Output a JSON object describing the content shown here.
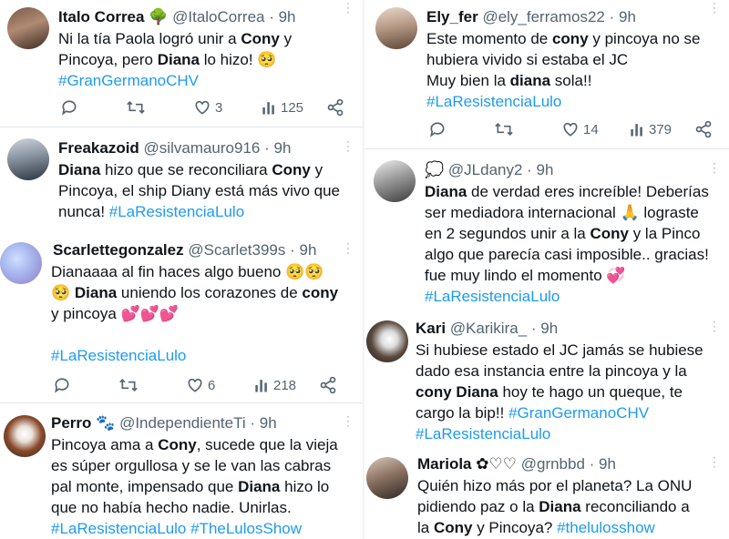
{
  "tweets": [
    {
      "name": "Italo Correa",
      "badge": "🌳",
      "handle": "@ItaloCorrea",
      "time": "· 9h",
      "lines": [
        [
          {
            "t": "Ni la tía Paola logró unir a "
          },
          {
            "t": "Cony",
            "b": 1
          },
          {
            "t": " y"
          }
        ],
        [
          {
            "t": "Pincoya, pero "
          },
          {
            "t": "Diana",
            "b": 1
          },
          {
            "t": " lo hizo! 🥺"
          }
        ],
        [
          {
            "t": "#GranGermanoCHV",
            "tag": 1
          }
        ]
      ],
      "replies": "",
      "retweets": "",
      "likes": "3",
      "views": "125"
    },
    {
      "name": "Freakazoid",
      "badge": "",
      "handle": "@silvamauro916",
      "time": "· 9h",
      "lines": [
        [
          {
            "t": "Diana",
            "b": 1
          },
          {
            "t": " hizo que se reconciliara "
          },
          {
            "t": "Cony",
            "b": 1
          },
          {
            "t": " y"
          }
        ],
        [
          {
            "t": "Pincoya, el ship Diany está más vivo que"
          }
        ],
        [
          {
            "t": "nunca! "
          },
          {
            "t": "#LaResistenciaLulo",
            "tag": 1
          }
        ]
      ]
    },
    {
      "name": "Scarlettegonzalez",
      "badge": "",
      "handle": "@Scarlet399s",
      "time": "· 9h",
      "lines": [
        [
          {
            "t": "Dianaaaa al fin haces algo bueno 🥺🥺"
          }
        ],
        [
          {
            "t": "🥺 "
          },
          {
            "t": "Diana",
            "b": 1
          },
          {
            "t": " uniendo los corazones de "
          },
          {
            "t": "cony",
            "b": 1
          }
        ],
        [
          {
            "t": "y pincoya 💕💕💕"
          }
        ],
        [
          {
            "t": ""
          }
        ],
        [
          {
            "t": "#LaResistenciaLulo",
            "tag": 1
          }
        ]
      ],
      "replies": "",
      "retweets": "",
      "likes": "6",
      "views": "218"
    },
    {
      "name": "Perro",
      "badge": "🐾",
      "handle": "@IndependienteTi",
      "time": "· 9h",
      "lines": [
        [
          {
            "t": "Pincoya ama a "
          },
          {
            "t": "Cony",
            "b": 1
          },
          {
            "t": ", sucede que la vieja"
          }
        ],
        [
          {
            "t": "es súper orgullosa y se le van las cabras"
          }
        ],
        [
          {
            "t": "pal monte, impensado que "
          },
          {
            "t": "Diana",
            "b": 1
          },
          {
            "t": " hizo lo"
          }
        ],
        [
          {
            "t": "que no había hecho nadie. Unirlas."
          }
        ],
        [
          {
            "t": "#LaResistenciaLulo #TheLulosShow",
            "tag": 1
          }
        ]
      ]
    },
    {
      "name": "Ely_fer",
      "badge": "",
      "handle": "@ely_ferramos22",
      "time": "· 9h",
      "lines": [
        [
          {
            "t": "Este momento de "
          },
          {
            "t": "cony",
            "b": 1
          },
          {
            "t": " y pincoya  no se"
          }
        ],
        [
          {
            "t": "hubiera vivido si estaba el JC"
          }
        ],
        [
          {
            "t": "Muy bien la "
          },
          {
            "t": "diana",
            "b": 1
          },
          {
            "t": " sola!!"
          }
        ],
        [
          {
            "t": "#LaResistenciaLulo",
            "tag": 1
          }
        ]
      ],
      "replies": "",
      "retweets": "",
      "likes": "14",
      "views": "379"
    },
    {
      "name": "💭",
      "badge": "",
      "handle": "@JLdany2",
      "time": "· 9h",
      "lines": [
        [
          {
            "t": "Diana",
            "b": 1
          },
          {
            "t": " de verdad eres increíble! Deberías"
          }
        ],
        [
          {
            "t": "ser mediadora internacional 🙏 lograste"
          }
        ],
        [
          {
            "t": "en 2 segundos unir a la "
          },
          {
            "t": "Cony",
            "b": 1
          },
          {
            "t": " y la Pinco"
          }
        ],
        [
          {
            "t": "algo que parecía casi imposible.. gracias!"
          }
        ],
        [
          {
            "t": "fue muy lindo el momento 💞"
          }
        ],
        [
          {
            "t": "#LaResistenciaLulo",
            "tag": 1
          }
        ]
      ]
    },
    {
      "name": "Kari",
      "badge": "",
      "handle": "@Karikira_",
      "time": "· 9h",
      "lines": [
        [
          {
            "t": "Si hubiese estado el JC jamás se hubiese"
          }
        ],
        [
          {
            "t": "dado esa instancia entre la pincoya y la"
          }
        ],
        [
          {
            "t": "cony",
            "b": 1
          },
          {
            "t": " "
          },
          {
            "t": "Diana",
            "b": 1
          },
          {
            "t": " hoy te hago un queque, te"
          }
        ],
        [
          {
            "t": "cargo la bip!! "
          },
          {
            "t": "#GranGermanoCHV",
            "tag": 1
          }
        ],
        [
          {
            "t": "#LaResistenciaLulo",
            "tag": 1
          }
        ]
      ]
    },
    {
      "name": "Mariola",
      "badge": "✿♡♡",
      "handle": "@grnbbd",
      "time": "· 9h",
      "lines": [
        [
          {
            "t": "Quién hizo más por el planeta? La ONU"
          }
        ],
        [
          {
            "t": "pidiendo paz o la "
          },
          {
            "t": "Diana",
            "b": 1
          },
          {
            "t": " reconciliando a"
          }
        ],
        [
          {
            "t": "la "
          },
          {
            "t": "Cony",
            "b": 1
          },
          {
            "t": " y Pincoya? "
          },
          {
            "t": "#thelulosshow",
            "tag": 1
          }
        ]
      ]
    }
  ],
  "colors": {
    "text": "#0f1419",
    "muted": "#536471",
    "link": "#1d9bf0",
    "divider": "#e1e6ea"
  },
  "icons": [
    "reply-icon",
    "retweet-icon",
    "like-icon",
    "views-icon",
    "share-icon",
    "more-icon"
  ]
}
